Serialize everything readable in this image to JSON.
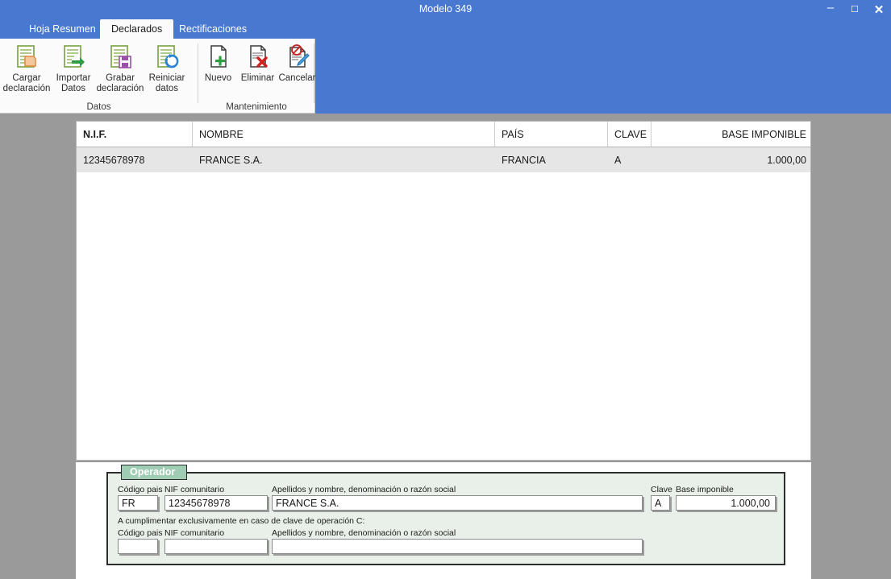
{
  "window": {
    "title": "Modelo 349",
    "controls": [
      {
        "name": "minimize-button",
        "glyph": "–"
      },
      {
        "name": "maximize-button",
        "glyph": "☐"
      },
      {
        "name": "close-button",
        "glyph": "✕"
      }
    ]
  },
  "tabs": [
    {
      "label": "Hoja Resumen",
      "active": false
    },
    {
      "label": "Declarados",
      "active": true
    },
    {
      "label": "Rectificaciones",
      "active": false
    }
  ],
  "ribbon": {
    "groups": [
      {
        "label": "Datos",
        "buttons": [
          {
            "icon": "load-declaration-icon",
            "label": "Cargar\ndeclaración"
          },
          {
            "icon": "import-data-icon",
            "label": "Importar\nDatos"
          },
          {
            "icon": "save-declaration-icon",
            "label": "Grabar\ndeclaración"
          },
          {
            "icon": "reset-data-icon",
            "label": "Reiniciar\ndatos"
          }
        ]
      },
      {
        "label": "Mantenimiento",
        "buttons": [
          {
            "icon": "new-document-icon",
            "label": "Nuevo"
          },
          {
            "icon": "delete-document-icon",
            "label": "Eliminar"
          },
          {
            "icon": "cancel-edit-icon",
            "label": "Cancelar"
          }
        ]
      }
    ]
  },
  "grid": {
    "columns": [
      "N.I.F.",
      "NOMBRE",
      "PAÍS",
      "CLAVE",
      "BASE IMPONIBLE"
    ],
    "rows": [
      {
        "nif": "12345678978",
        "nombre": "FRANCE S.A.",
        "pais": "FRANCIA",
        "clave": "A",
        "base_imponible": "1.000,00"
      }
    ]
  },
  "detail": {
    "legend": "Operador",
    "primary": {
      "codigo_pais_label": "Código pais",
      "codigo_pais_value": "FR",
      "nif_label": "NIF comunitario",
      "nif_value": "12345678978",
      "nombre_label": "Apellidos y nombre, denominación o razón social",
      "nombre_value": "FRANCE S.A.",
      "clave_label": "Clave",
      "clave_value": "A",
      "base_label": "Base imponible",
      "base_value": "1.000,00"
    },
    "note": "A cumplimentar exclusivamente en caso de clave de operación C:",
    "secondary": {
      "codigo_pais_label": "Código pais",
      "codigo_pais_value": "",
      "nif_label": "NIF comunitario",
      "nif_value": "",
      "nombre_label": "Apellidos y nombre, denominación o razón social",
      "nombre_value": ""
    }
  },
  "colors": {
    "titlebar": "#4878d0",
    "ribbon_bg": "#fbfbfb",
    "workarea_bg": "#9a9a9a",
    "row_bg": "#e6e6e6",
    "fieldset_bg": "#e9f0e9",
    "legend_bg": "#9fcdb3"
  }
}
